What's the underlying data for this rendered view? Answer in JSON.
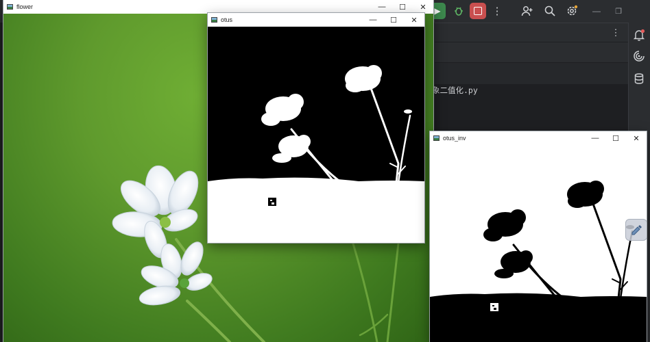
{
  "ide": {
    "code_text": "象二值化.py"
  },
  "windows": {
    "flower": {
      "title": "flower"
    },
    "otus": {
      "title": "otus"
    },
    "otus_inv": {
      "title": "otus_inv"
    }
  },
  "controls": {
    "minimize": "—",
    "maximize": "☐",
    "close": "✕"
  },
  "colors": {
    "ide_bg": "#1e1f22",
    "ide_panel": "#2b2d30",
    "run_green": "#3d8a4e",
    "stop_red": "#c94f4f",
    "notify_dot": "#e55b5b",
    "grass_green": "#5f9a2d"
  }
}
